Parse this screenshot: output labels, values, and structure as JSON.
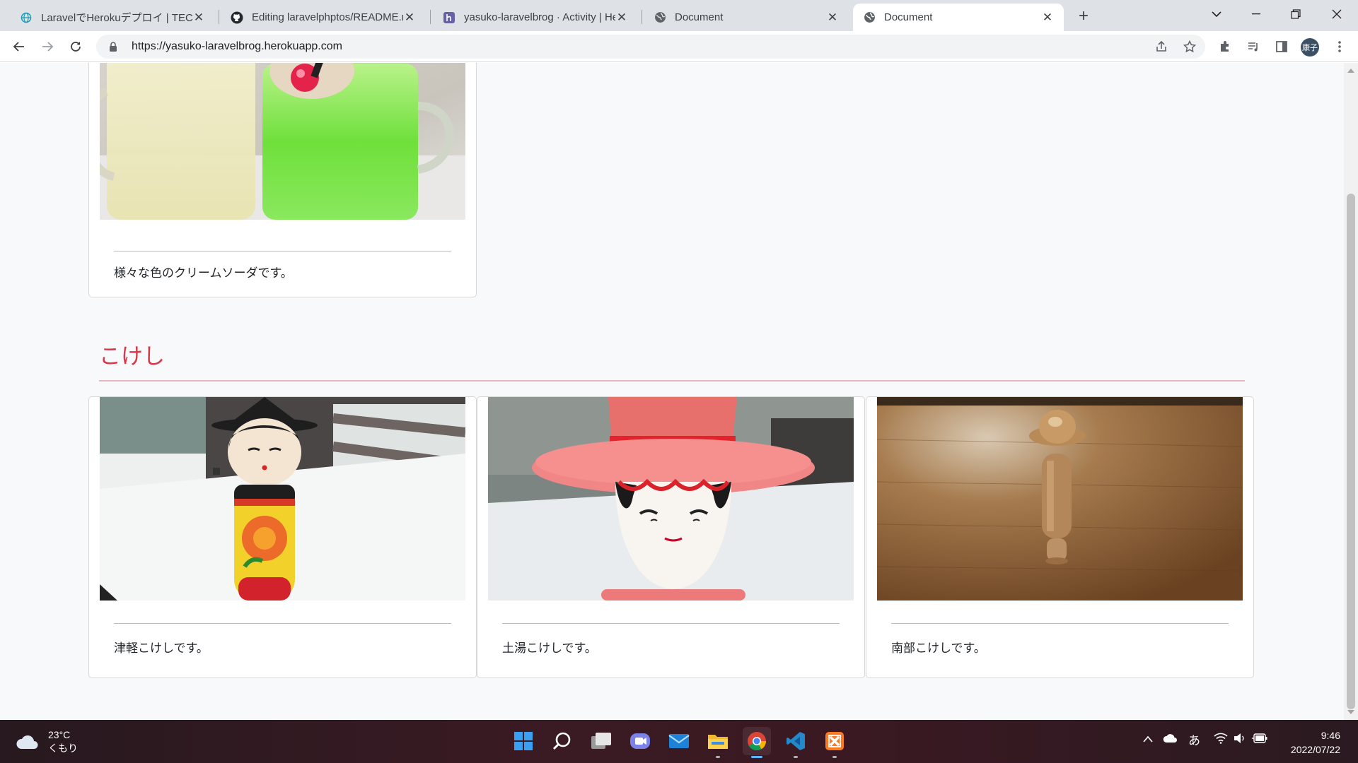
{
  "browser": {
    "tabs": [
      {
        "title": "LaravelでHerokuデプロイ | TECH I.S.",
        "icon": "globe-icon",
        "active": false
      },
      {
        "title": "Editing laravelphptos/README.md",
        "icon": "github-icon",
        "active": false
      },
      {
        "title": "yasuko-laravelbrog · Activity | Heroku",
        "icon": "heroku-icon",
        "active": false
      },
      {
        "title": "Document",
        "icon": "globe-icon",
        "active": false
      },
      {
        "title": "Document",
        "icon": "globe-icon",
        "active": true
      }
    ],
    "url": "https://yasuko-laravelbrog.herokuapp.com",
    "profile_initials": "康子"
  },
  "page": {
    "top_section": {
      "cards": [
        {
          "caption": "様々な色のクリームソーダです。",
          "image": "cream-soda-photo"
        }
      ]
    },
    "kokeshi_section": {
      "heading": "こけし",
      "cards": [
        {
          "caption": "津軽こけしです。",
          "image": "tsugaru-kokeshi-photo"
        },
        {
          "caption": "土湯こけしです。",
          "image": "tsuchiyu-kokeshi-photo"
        },
        {
          "caption": "南部こけしです。",
          "image": "nanbu-kokeshi-photo"
        }
      ]
    }
  },
  "taskbar": {
    "weather_temp": "23°C",
    "weather_desc": "くもり",
    "ime": "あ",
    "time": "9:46",
    "date": "2022/07/22"
  },
  "colors": {
    "heading": "#dc3545",
    "page_bg": "#f8f9fa",
    "taskbar": "#3a1a23"
  }
}
